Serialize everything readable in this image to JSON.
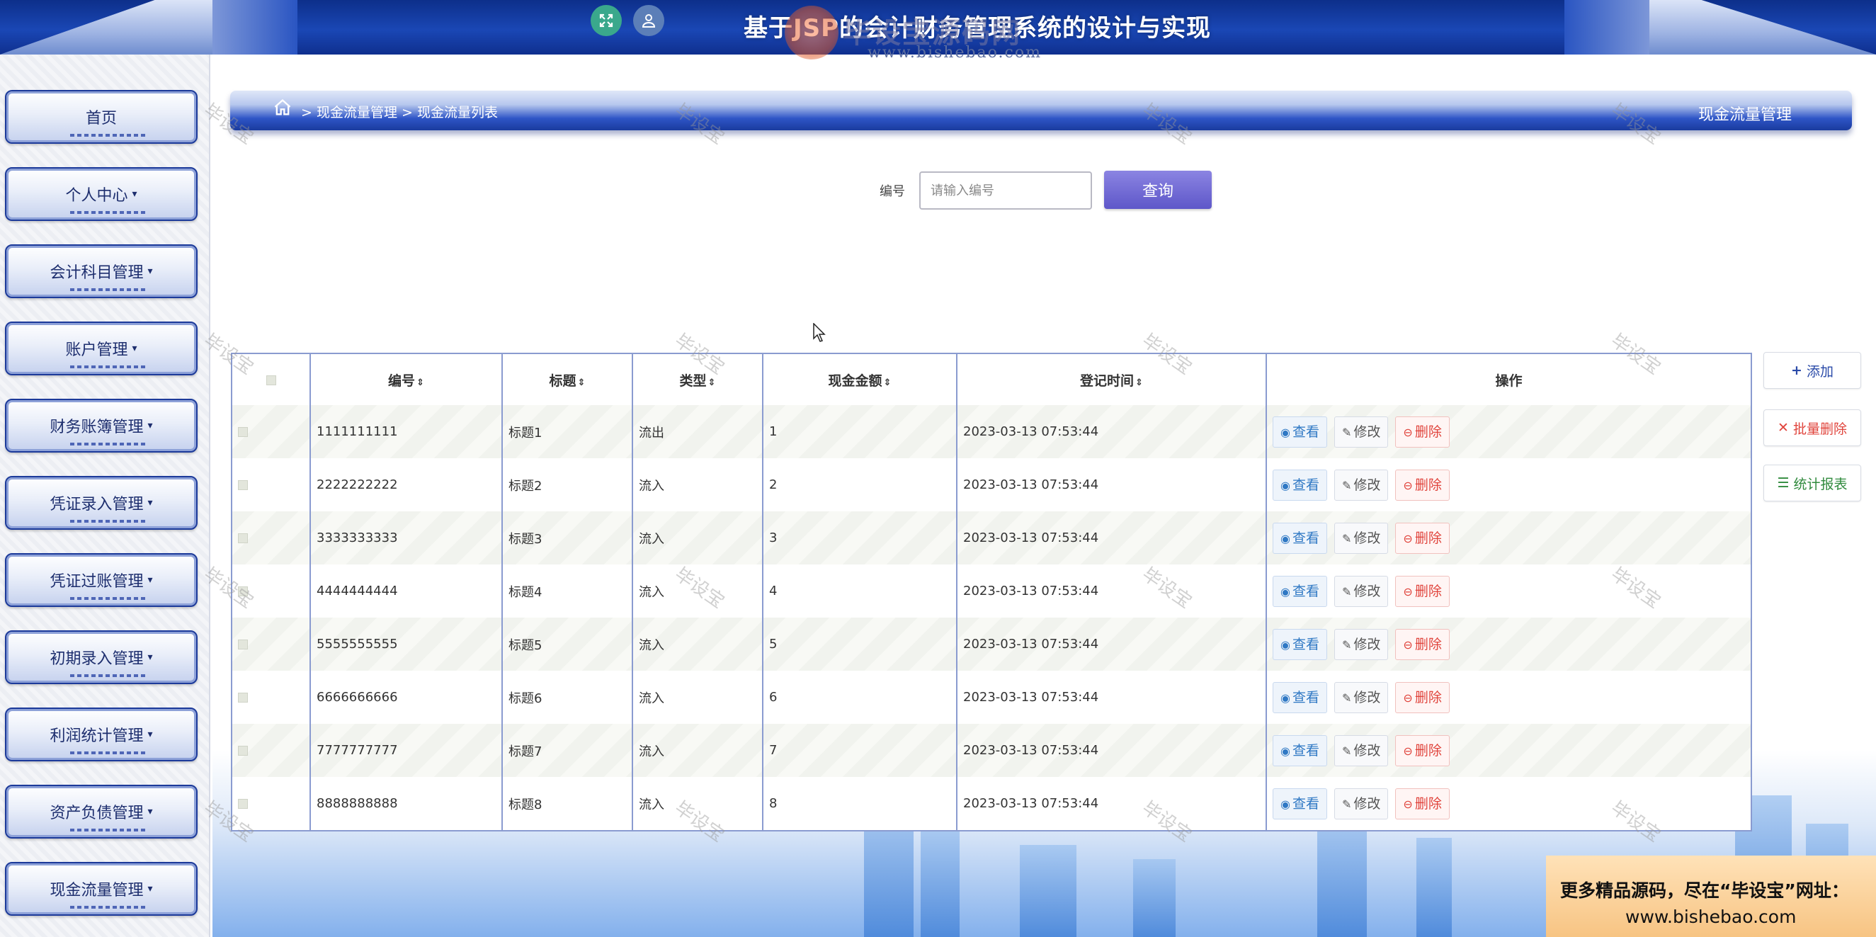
{
  "header": {
    "title": "基于JSP的会计财务管理系统的设计与实现",
    "watermark_brand": "毕设宝源码网",
    "watermark_url": "www.bishebao.com"
  },
  "sidebar": {
    "items": [
      {
        "label": "首页",
        "has_caret": false
      },
      {
        "label": "个人中心",
        "has_caret": true
      },
      {
        "label": "会计科目管理",
        "has_caret": true
      },
      {
        "label": "账户管理",
        "has_caret": true
      },
      {
        "label": "财务账簿管理",
        "has_caret": true
      },
      {
        "label": "凭证录入管理",
        "has_caret": true
      },
      {
        "label": "凭证过账管理",
        "has_caret": true
      },
      {
        "label": "初期录入管理",
        "has_caret": true
      },
      {
        "label": "利润统计管理",
        "has_caret": true
      },
      {
        "label": "资产负债管理",
        "has_caret": true
      },
      {
        "label": "现金流量管理",
        "has_caret": true
      }
    ]
  },
  "breadcrumb": {
    "path": " > 现金流量管理 > 现金流量列表",
    "section": "现金流量管理"
  },
  "search": {
    "label": "编号",
    "placeholder": "请输入编号",
    "value": "",
    "button": "查询"
  },
  "table": {
    "columns": [
      "",
      "编号",
      "标题",
      "类型",
      "现金金额",
      "登记时间",
      "操作"
    ],
    "sort_glyph": "⇕",
    "actions": {
      "view": "查看",
      "edit": "修改",
      "delete": "删除"
    },
    "rows": [
      {
        "id": "1111111111",
        "title": "标题1",
        "type": "流出",
        "amount": "1",
        "time": "2023-03-13 07:53:44"
      },
      {
        "id": "2222222222",
        "title": "标题2",
        "type": "流入",
        "amount": "2",
        "time": "2023-03-13 07:53:44"
      },
      {
        "id": "3333333333",
        "title": "标题3",
        "type": "流入",
        "amount": "3",
        "time": "2023-03-13 07:53:44"
      },
      {
        "id": "4444444444",
        "title": "标题4",
        "type": "流入",
        "amount": "4",
        "time": "2023-03-13 07:53:44"
      },
      {
        "id": "5555555555",
        "title": "标题5",
        "type": "流入",
        "amount": "5",
        "time": "2023-03-13 07:53:44"
      },
      {
        "id": "6666666666",
        "title": "标题6",
        "type": "流入",
        "amount": "6",
        "time": "2023-03-13 07:53:44"
      },
      {
        "id": "7777777777",
        "title": "标题7",
        "type": "流入",
        "amount": "7",
        "time": "2023-03-13 07:53:44"
      },
      {
        "id": "8888888888",
        "title": "标题8",
        "type": "流入",
        "amount": "8",
        "time": "2023-03-13 07:53:44"
      }
    ]
  },
  "side_actions": {
    "add": "添加",
    "batch_delete": "批量删除",
    "stats": "统计报表"
  },
  "watermark": "毕设宝",
  "promo": {
    "line1": "更多精品源码，尽在“毕设宝”网址：",
    "line2": "www.bishebao.com"
  },
  "colors": {
    "header_blue": "#1a47b5",
    "search_button": "#6e67d4",
    "delete_red": "#e0443c",
    "view_blue": "#2f78c4",
    "stats_green": "#2f8a3c"
  }
}
